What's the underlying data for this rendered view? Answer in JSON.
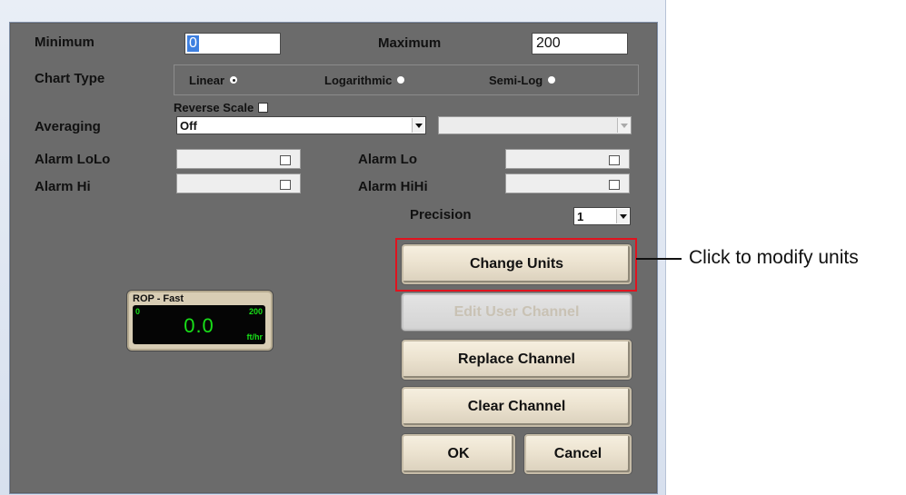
{
  "dialog": {
    "minimum": {
      "label": "Minimum",
      "value": "0"
    },
    "maximum": {
      "label": "Maximum",
      "value": "200"
    },
    "chart_type": {
      "label": "Chart Type",
      "options": [
        "Linear",
        "Logarithmic",
        "Semi-Log"
      ],
      "selected": "Linear"
    },
    "reverse_scale": {
      "label": "Reverse Scale",
      "checked": false
    },
    "averaging": {
      "label": "Averaging",
      "value": "Off",
      "secondary_value": ""
    },
    "alarms": {
      "lolo": "Alarm LoLo",
      "lo": "Alarm Lo",
      "hi": "Alarm Hi",
      "hihi": "Alarm HiHi"
    },
    "precision": {
      "label": "Precision",
      "value": "1"
    },
    "gauge": {
      "title": "ROP - Fast",
      "min": "0",
      "max": "200",
      "value": "0.0",
      "unit": "ft/hr",
      "color": "#18e018"
    },
    "buttons": {
      "change_units": "Change Units",
      "edit_user_channel": "Edit User Channel",
      "replace_channel": "Replace Channel",
      "clear_channel": "Clear Channel",
      "ok": "OK",
      "cancel": "Cancel"
    }
  },
  "annotation": {
    "text": "Click to modify units",
    "highlight_color": "#e0131f"
  }
}
